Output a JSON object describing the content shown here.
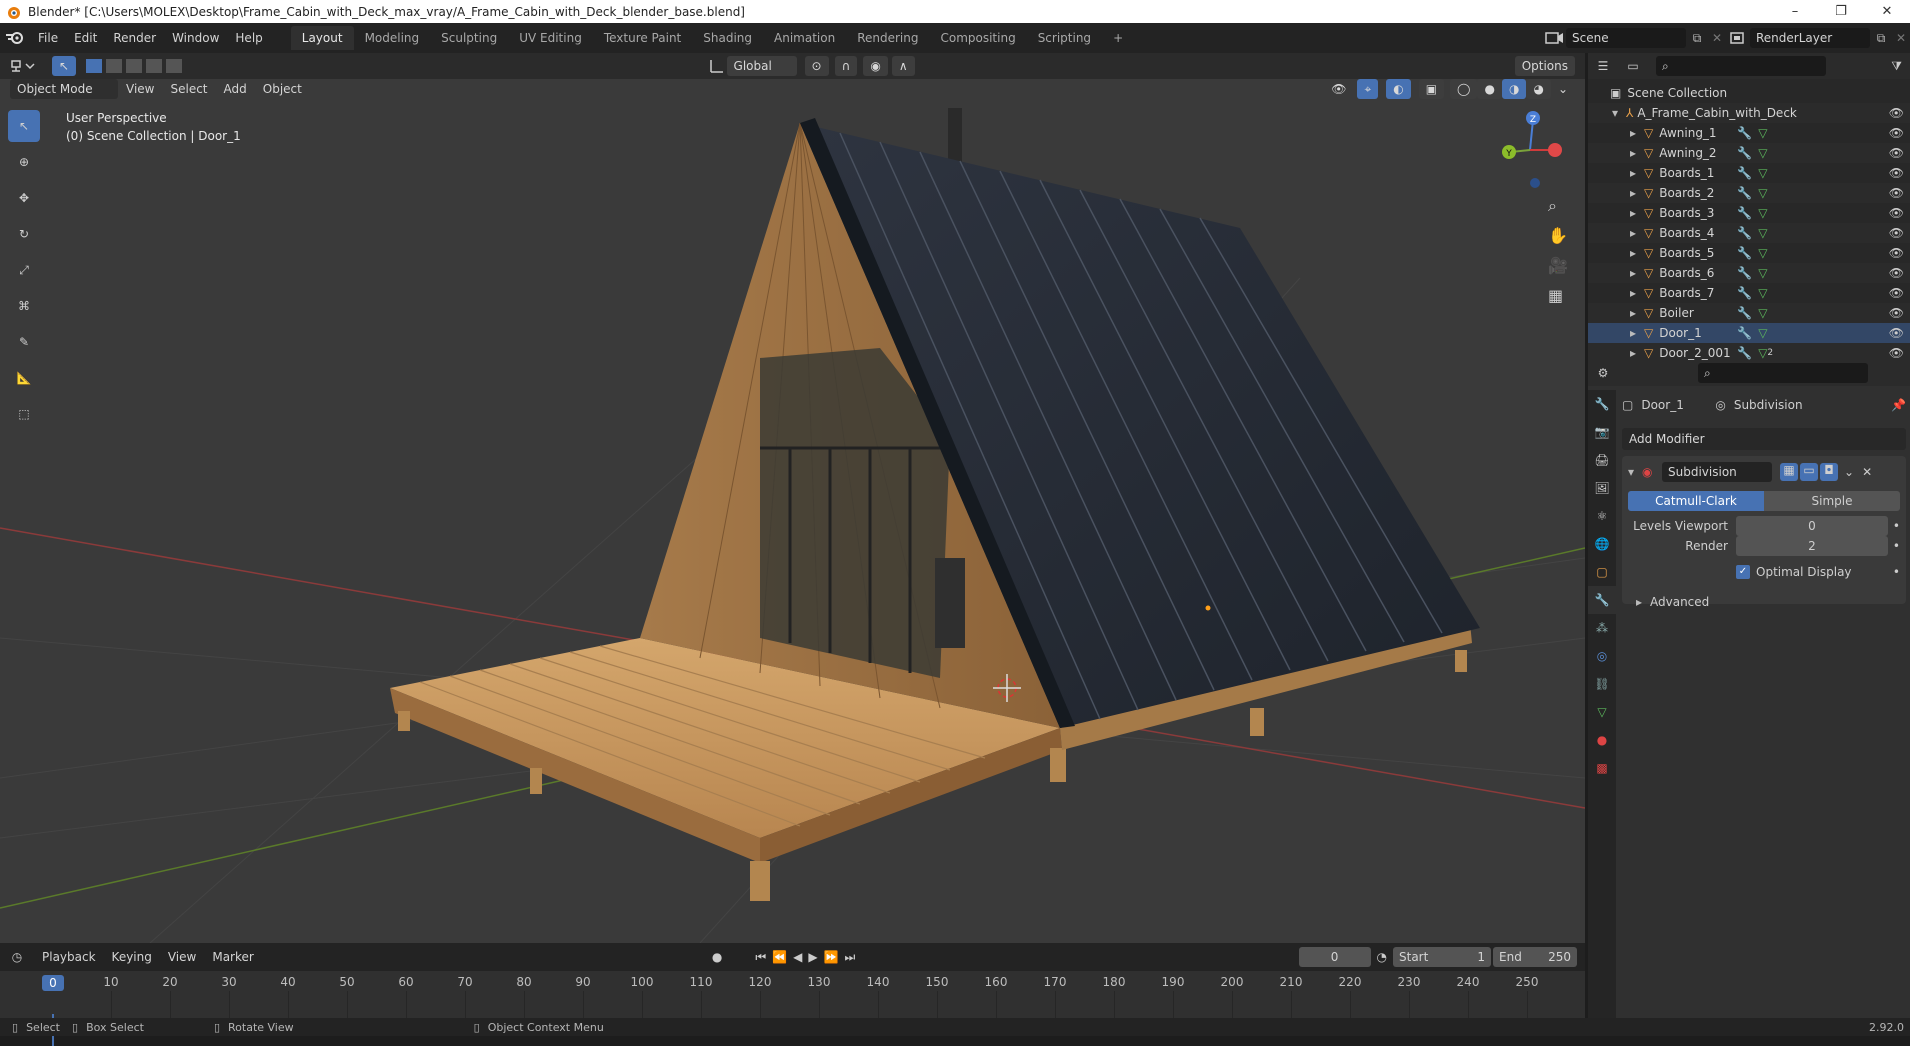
{
  "window": {
    "title": "Blender* [C:\\Users\\MOLEX\\Desktop\\Frame_Cabin_with_Deck_max_vray/A_Frame_Cabin_with_Deck_blender_base.blend]",
    "minimize": "–",
    "restore": "❐",
    "close": "✕"
  },
  "menu": [
    "File",
    "Edit",
    "Render",
    "Window",
    "Help"
  ],
  "workspaces": [
    "Layout",
    "Modeling",
    "Sculpting",
    "UV Editing",
    "Texture Paint",
    "Shading",
    "Animation",
    "Rendering",
    "Compositing",
    "Scripting"
  ],
  "workspace_add": "+",
  "scene": {
    "name": "Scene",
    "render_layer": "RenderLayer"
  },
  "viewport_header": {
    "orientation": "Global",
    "options": "Options",
    "mode": "Object Mode",
    "menus": [
      "View",
      "Select",
      "Add",
      "Object"
    ]
  },
  "viewport": {
    "perspective": "User Perspective",
    "collection": "(0) Scene Collection | Door_1",
    "gizmo": {
      "z": "Z",
      "y": "Y"
    }
  },
  "outliner": {
    "root": "Scene Collection",
    "parent": "A_Frame_Cabin_with_Deck",
    "items": [
      "Awning_1",
      "Awning_2",
      "Boards_1",
      "Boards_2",
      "Boards_3",
      "Boards_4",
      "Boards_5",
      "Boards_6",
      "Boards_7",
      "Boiler",
      "Door_1",
      "Door_2_001"
    ],
    "selected": "Door_1",
    "door2_badge": "2"
  },
  "properties": {
    "object": "Door_1",
    "modifier_name": "Subdivision",
    "add_modifier": "Add Modifier",
    "modifier_title": "Subdivision",
    "type_catmull": "Catmull-Clark",
    "type_simple": "Simple",
    "levels_viewport_label": "Levels Viewport",
    "levels_viewport": "0",
    "render_label": "Render",
    "render_value": "2",
    "optimal_display": "Optimal Display",
    "advanced": "Advanced"
  },
  "timeline": {
    "menus": [
      "Playback",
      "Keying",
      "View",
      "Marker"
    ],
    "current_frame": "0",
    "current_marker": "0",
    "start_label": "Start",
    "start": "1",
    "end_label": "End",
    "end": "250",
    "ticks": [
      "10",
      "20",
      "30",
      "40",
      "50",
      "60",
      "70",
      "80",
      "90",
      "100",
      "110",
      "120",
      "130",
      "140",
      "150",
      "160",
      "170",
      "180",
      "190",
      "200",
      "210",
      "220",
      "230",
      "240",
      "250"
    ]
  },
  "statusbar": {
    "select": "Select",
    "box_select": "Box Select",
    "rotate_view": "Rotate View",
    "context_menu": "Object Context Menu",
    "version": "2.92.0"
  }
}
